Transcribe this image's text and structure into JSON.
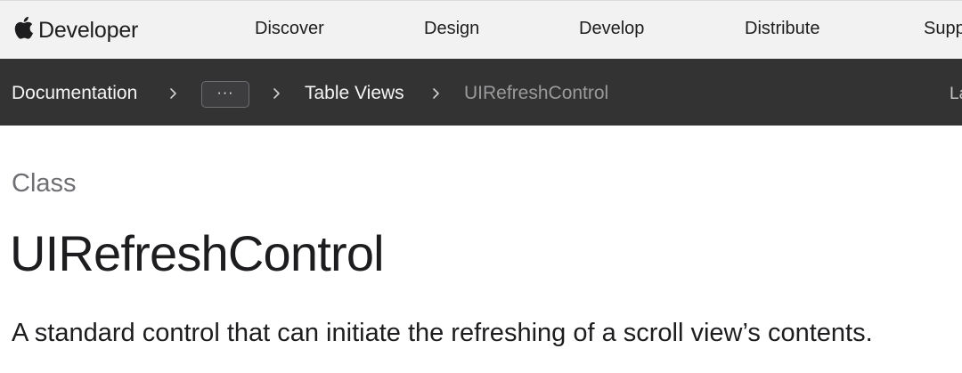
{
  "global_nav": {
    "brand_label": "Developer",
    "brand_icon": "apple-logo-icon",
    "items": [
      {
        "label": "Discover"
      },
      {
        "label": "Design"
      },
      {
        "label": "Develop"
      },
      {
        "label": "Distribute"
      },
      {
        "label": "Supp"
      }
    ]
  },
  "doc_nav": {
    "breadcrumbs": [
      {
        "label": "Documentation"
      },
      {
        "label": "···"
      },
      {
        "label": "Table Views"
      },
      {
        "label": "UIRefreshControl"
      }
    ],
    "separator_icon": "chevron-right-icon",
    "language_label_partial": "La"
  },
  "main": {
    "eyebrow": "Class",
    "title": "UIRefreshControl",
    "abstract": "A standard control that can initiate the refreshing of a scroll view’s contents."
  },
  "colors": {
    "nav_bg": "#f2f2f2",
    "docbar_bg": "#333333",
    "text_primary": "#1d1d1f",
    "text_secondary": "#6e6e73",
    "breadcrumb_current": "#9a9a9c"
  }
}
